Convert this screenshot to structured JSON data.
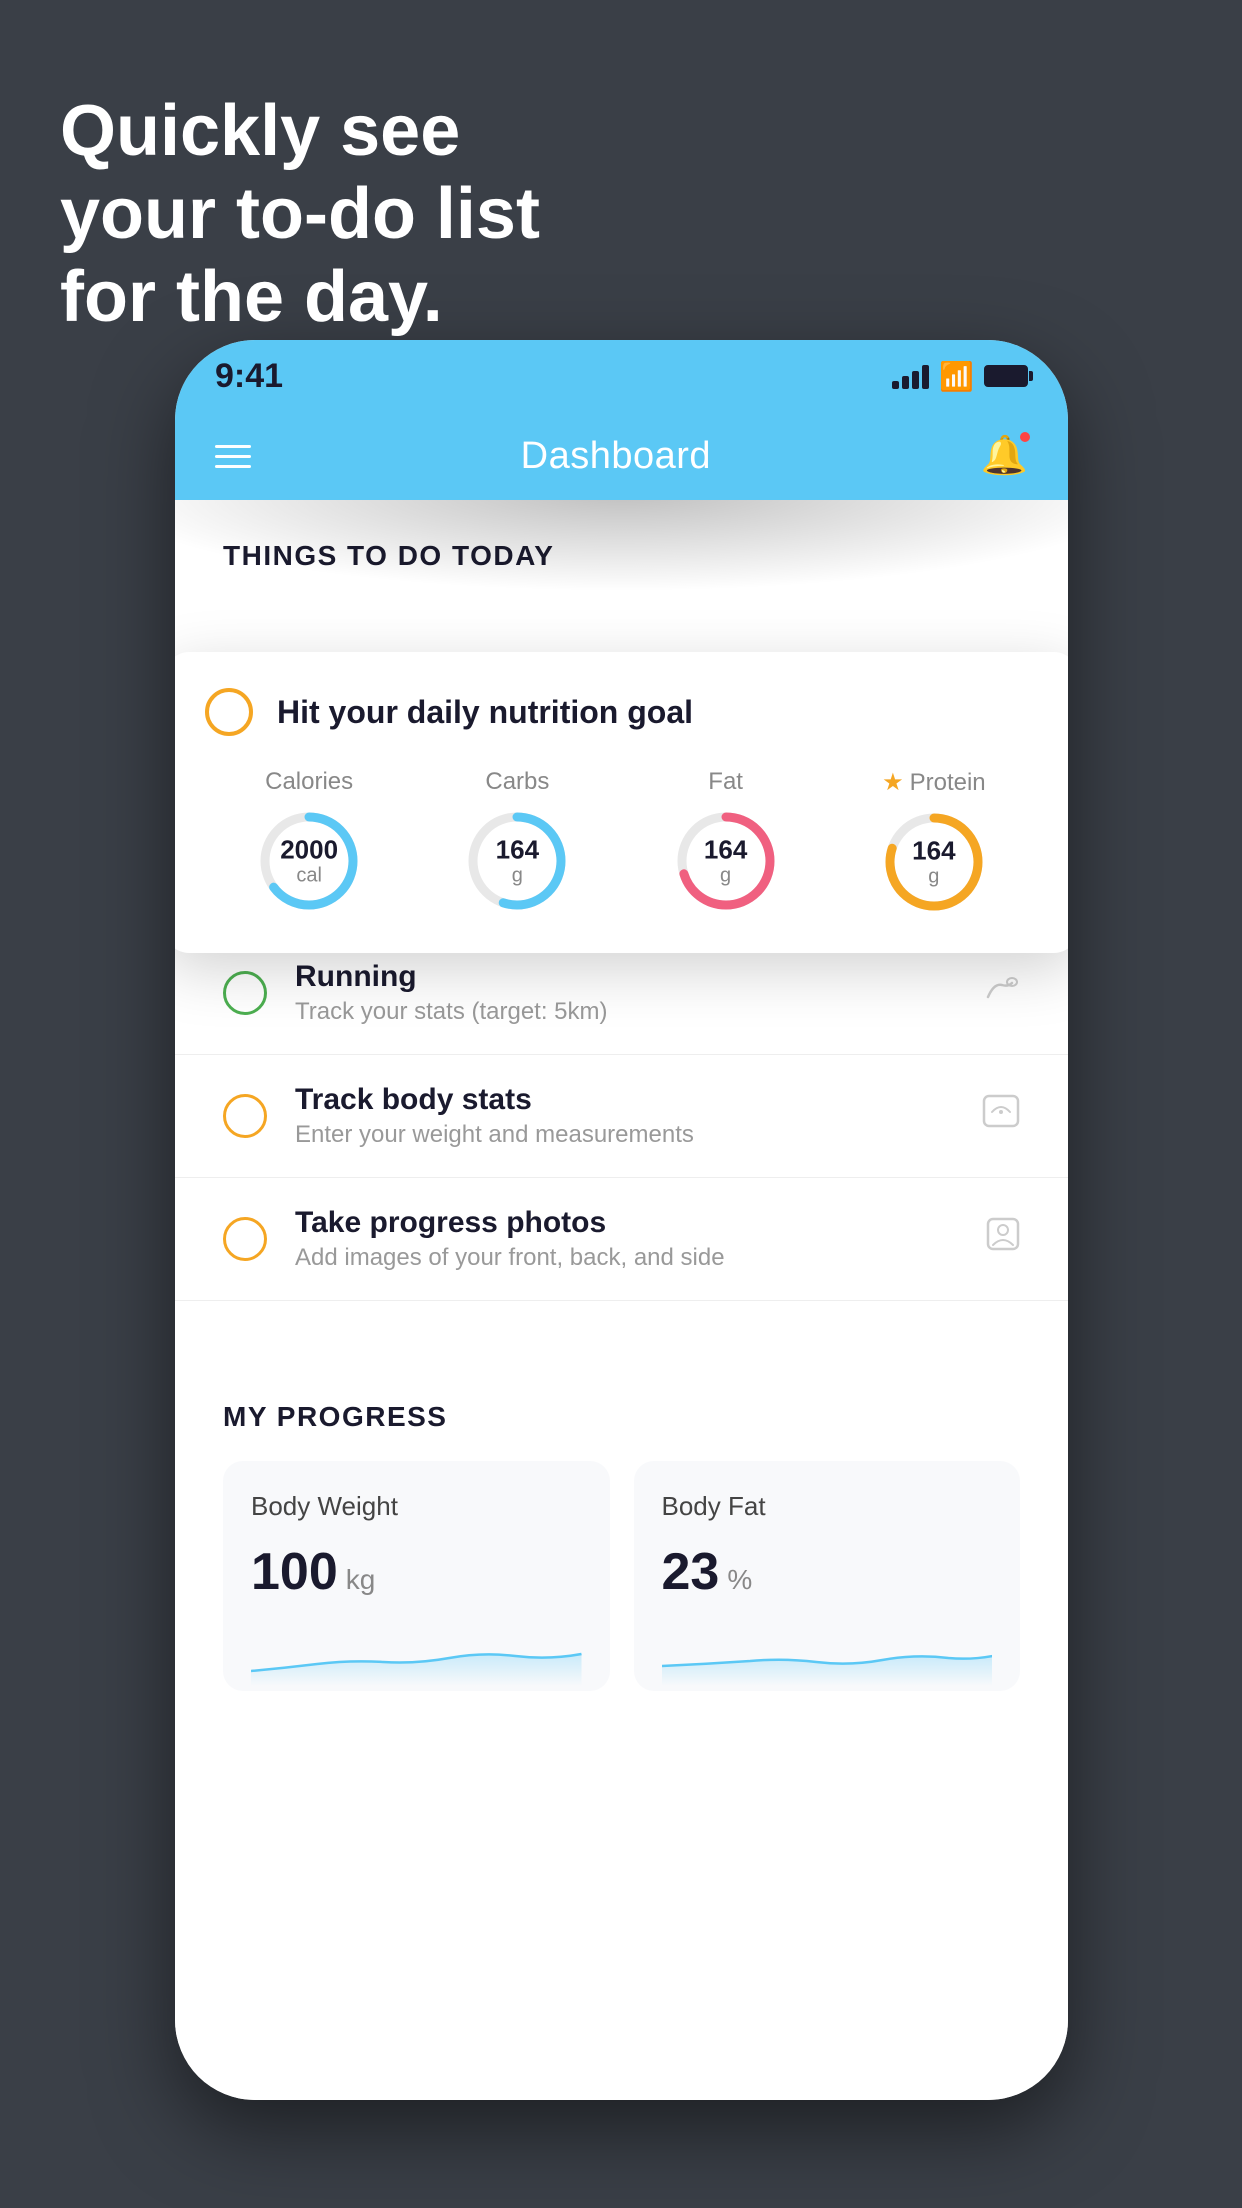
{
  "headline": {
    "line1": "Quickly see",
    "line2": "your to-do list",
    "line3": "for the day."
  },
  "status_bar": {
    "time": "9:41"
  },
  "nav": {
    "title": "Dashboard"
  },
  "things_section": {
    "header": "THINGS TO DO TODAY"
  },
  "nutrition_card": {
    "check_label": "",
    "title": "Hit your daily nutrition goal",
    "items": [
      {
        "label": "Calories",
        "value": "2000",
        "unit": "cal",
        "color": "#5bc8f5",
        "percent": 65,
        "starred": false
      },
      {
        "label": "Carbs",
        "value": "164",
        "unit": "g",
        "color": "#5bc8f5",
        "percent": 55,
        "starred": false
      },
      {
        "label": "Fat",
        "value": "164",
        "unit": "g",
        "color": "#f06080",
        "percent": 70,
        "starred": false
      },
      {
        "label": "Protein",
        "value": "164",
        "unit": "g",
        "color": "#f5a623",
        "percent": 80,
        "starred": true
      }
    ]
  },
  "todo_items": [
    {
      "title": "Running",
      "subtitle": "Track your stats (target: 5km)",
      "circle": "green",
      "icon": "👟"
    },
    {
      "title": "Track body stats",
      "subtitle": "Enter your weight and measurements",
      "circle": "yellow",
      "icon": "⊡"
    },
    {
      "title": "Take progress photos",
      "subtitle": "Add images of your front, back, and side",
      "circle": "yellow",
      "icon": "👤"
    }
  ],
  "progress_section": {
    "header": "MY PROGRESS",
    "cards": [
      {
        "title": "Body Weight",
        "value": "100",
        "unit": "kg"
      },
      {
        "title": "Body Fat",
        "value": "23",
        "unit": "%"
      }
    ]
  }
}
